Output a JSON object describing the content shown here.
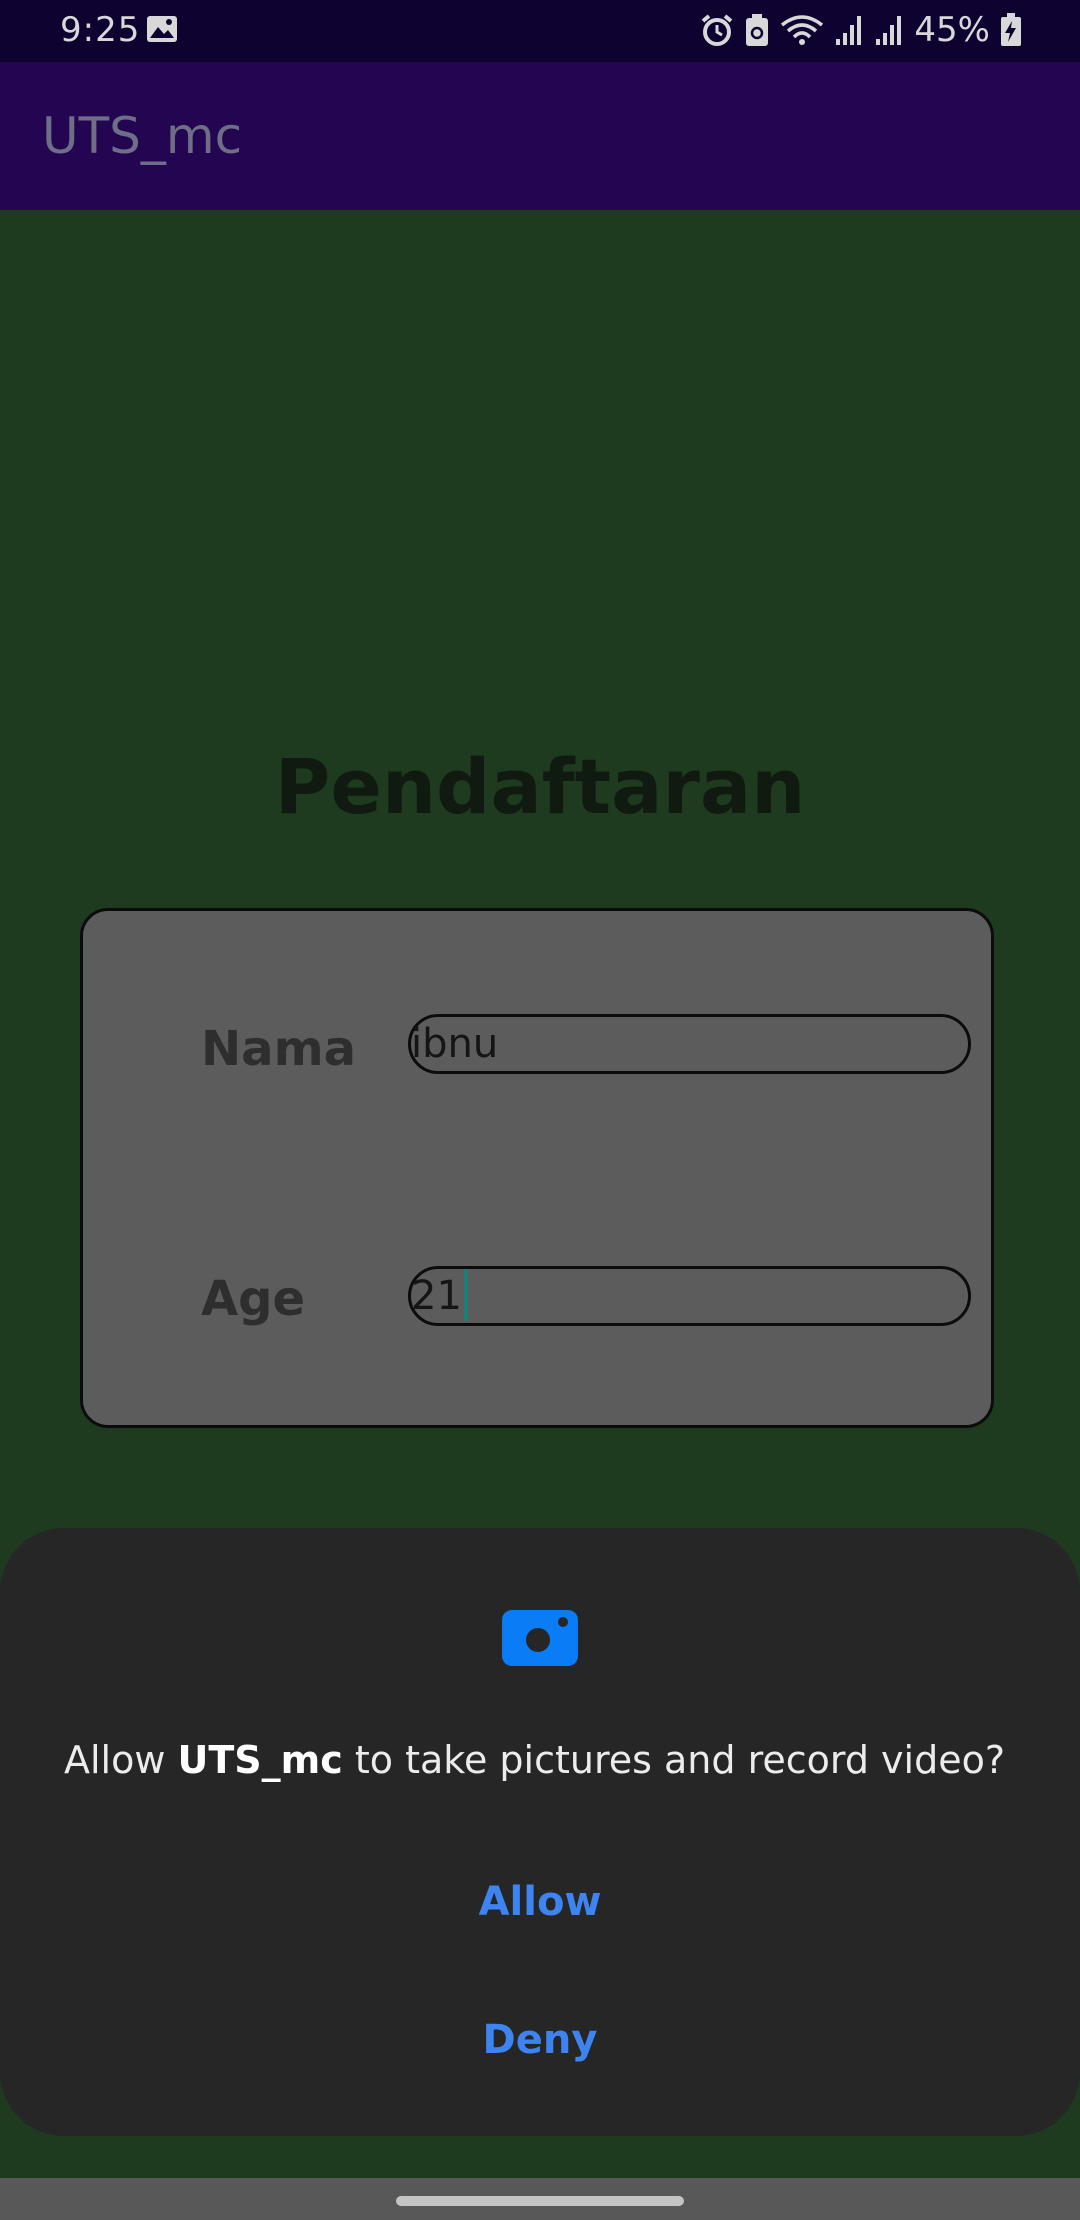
{
  "status_bar": {
    "time": "9:25",
    "battery_percent": "45%",
    "icons": [
      "gallery-icon",
      "alarm-icon",
      "recycle-icon",
      "wifi-icon",
      "signal-icon",
      "signal-icon",
      "battery-charging-icon"
    ]
  },
  "app_bar": {
    "title": "UTS_mc"
  },
  "form": {
    "heading": "Pendaftaran",
    "fields": [
      {
        "label": "Nama",
        "value": "ibnu"
      },
      {
        "label": "Age",
        "value": "21"
      }
    ]
  },
  "permission_dialog": {
    "icon": "camera-icon",
    "message_prefix": "Allow ",
    "app_name": "UTS_mc",
    "message_suffix": " to take pictures and record video?",
    "allow_label": "Allow",
    "deny_label": "Deny",
    "accent_color": "#3e84f0",
    "icon_color": "#0a7cf5"
  },
  "colors": {
    "status_bar": "#0e0330",
    "app_bar": "#230552",
    "background": "#1e3b1f",
    "card": "#5c5c5c",
    "dialog": "#262626"
  }
}
